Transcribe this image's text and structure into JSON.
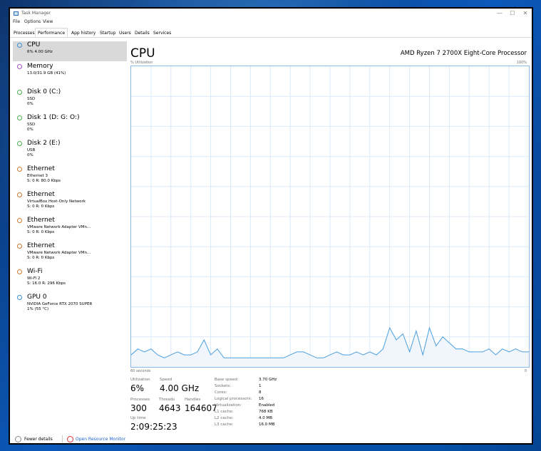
{
  "window": {
    "title": "Task Manager",
    "controls": [
      "—",
      "☐",
      "✕"
    ]
  },
  "menu": [
    "File",
    "Options",
    "View"
  ],
  "tabs": [
    "Processes",
    "Performance",
    "App history",
    "Startup",
    "Users",
    "Details",
    "Services"
  ],
  "active_tab": "Performance",
  "sidebar": [
    {
      "title": "CPU",
      "lines": [
        "6% 4.00 GHz"
      ],
      "color": "#3b8fd8",
      "selected": true
    },
    {
      "title": "Memory",
      "lines": [
        "13.0/31.9 GB (41%)"
      ],
      "color": "#a64ec6"
    },
    {
      "title": "Disk 0 (C:)",
      "lines": [
        "SSD",
        "0%"
      ],
      "color": "#4caf50"
    },
    {
      "title": "Disk 1 (D: G: O:)",
      "lines": [
        "SSD",
        "0%"
      ],
      "color": "#4caf50"
    },
    {
      "title": "Disk 2 (E:)",
      "lines": [
        "USB",
        "0%"
      ],
      "color": "#4caf50"
    },
    {
      "title": "Ethernet",
      "lines": [
        "Ethernet 3",
        "S: 0 R: 80.0 Kbps"
      ],
      "color": "#c9792f"
    },
    {
      "title": "Ethernet",
      "lines": [
        "VirtualBox Host-Only Network",
        "S: 0 R: 0 Kbps"
      ],
      "color": "#c9792f"
    },
    {
      "title": "Ethernet",
      "lines": [
        "VMware Network Adapter VMn...",
        "S: 0 R: 0 Kbps"
      ],
      "color": "#c9792f"
    },
    {
      "title": "Ethernet",
      "lines": [
        "VMware Network Adapter VMn...",
        "S: 0 R: 0 Kbps"
      ],
      "color": "#c9792f"
    },
    {
      "title": "Wi-Fi",
      "lines": [
        "Wi-Fi 2",
        "S: 16.0 R: 296 Kbps"
      ],
      "color": "#c9792f"
    },
    {
      "title": "GPU 0",
      "lines": [
        "NVIDIA GeForce RTX 2070 SUPER",
        "1% (55 °C)"
      ],
      "color": "#3b8fd8"
    }
  ],
  "main": {
    "title": "CPU",
    "processor": "AMD Ryzen 7 2700X Eight-Core Processor",
    "graph_top_left": "% Utilization",
    "graph_top_right": "100%",
    "graph_bottom_left": "60 seconds",
    "graph_bottom_right": "0"
  },
  "stats": {
    "utilization_label": "Utilization",
    "utilization": "6%",
    "speed_label": "Speed",
    "speed": "4.00 GHz",
    "processes_label": "Processes",
    "processes": "300",
    "threads_label": "Threads",
    "threads": "4643",
    "handles_label": "Handles",
    "handles": "164607",
    "uptime_label": "Up time",
    "uptime": "2:09:25:23"
  },
  "specs": [
    {
      "label": "Base speed:",
      "value": "3.70 GHz"
    },
    {
      "label": "Sockets:",
      "value": "1"
    },
    {
      "label": "Cores:",
      "value": "8"
    },
    {
      "label": "Logical processors:",
      "value": "16"
    },
    {
      "label": "Virtualization:",
      "value": "Enabled"
    },
    {
      "label": "L1 cache:",
      "value": "768 KB"
    },
    {
      "label": "L2 cache:",
      "value": "4.0 MB"
    },
    {
      "label": "L3 cache:",
      "value": "16.0 MB"
    }
  ],
  "footer": {
    "fewer_details": "Fewer details",
    "resource_monitor": "Open Resource Monitor"
  },
  "chart_data": {
    "type": "area",
    "ylim": [
      0,
      100
    ],
    "xlim": [
      60,
      0
    ],
    "grid": true,
    "color": "#4a9fe0",
    "x": [
      60,
      59,
      58,
      57,
      56,
      55,
      54,
      53,
      52,
      51,
      50,
      49,
      48,
      47,
      46,
      45,
      44,
      43,
      42,
      41,
      40,
      39,
      38,
      37,
      36,
      35,
      34,
      33,
      32,
      31,
      30,
      29,
      28,
      27,
      26,
      25,
      24,
      23,
      22,
      21,
      20,
      19,
      18,
      17,
      16,
      15,
      14,
      13,
      12,
      11,
      10,
      9,
      8,
      7,
      6,
      5,
      4,
      3,
      2,
      1,
      0
    ],
    "y": [
      4,
      6,
      5,
      6,
      4,
      3,
      4,
      5,
      4,
      4,
      5,
      9,
      4,
      6,
      3,
      3,
      3,
      3,
      3,
      3,
      3,
      3,
      3,
      3,
      4,
      5,
      5,
      4,
      3,
      3,
      4,
      5,
      4,
      4,
      5,
      4,
      5,
      4,
      6,
      13,
      9,
      11,
      5,
      12,
      4,
      13,
      7,
      10,
      8,
      6,
      6,
      5,
      5,
      5,
      6,
      4,
      6,
      5,
      6,
      5,
      5
    ]
  }
}
